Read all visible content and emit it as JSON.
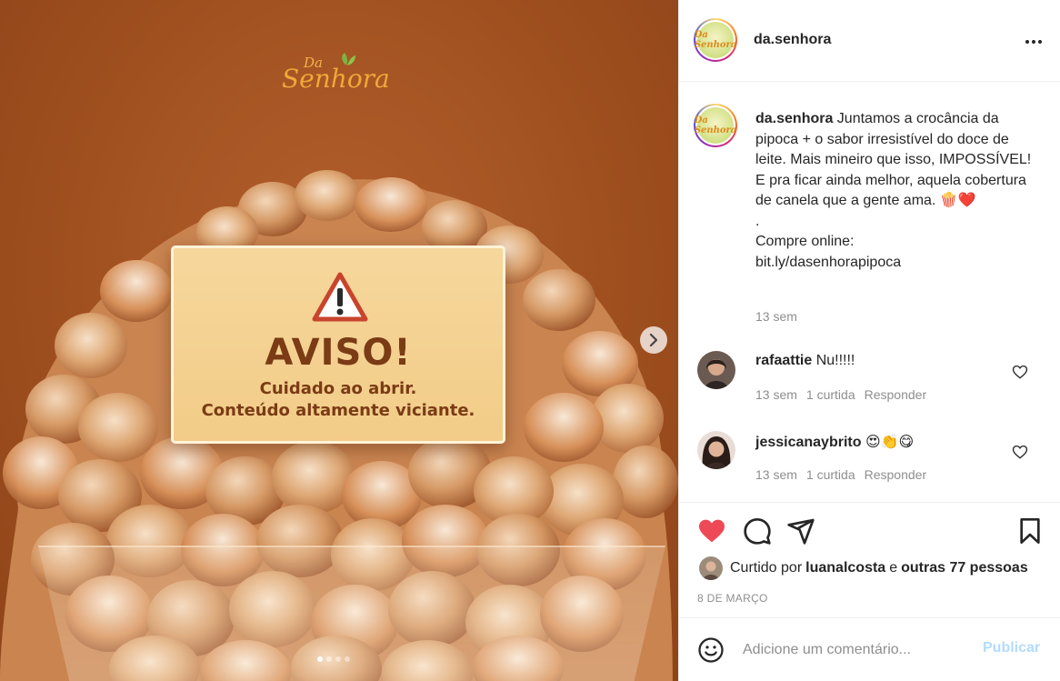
{
  "post_image": {
    "brand_logo": {
      "small": "Da",
      "large": "Senhora"
    },
    "warning": {
      "title": "AVISO!",
      "line1": "Cuidado ao abrir.",
      "line2": "Conteúdo altamente viciante."
    },
    "carousel": {
      "total_slides": 4,
      "active_slide": 1
    },
    "icons": {
      "next": "chevron-right-icon",
      "warning": "warning-triangle-icon"
    }
  },
  "header": {
    "username": "da.senhora",
    "avatar_text": "Da Senhora",
    "more_icon": "more-horizontal-icon"
  },
  "caption": {
    "username": "da.senhora",
    "text": " Juntamos a crocância da pipoca + o sabor irresistível do doce de leite. Mais mineiro que isso, IMPOSSÍVEL! E pra ficar ainda melhor, aquela cobertura de canela que a gente ama. 🍿❤️\n.\nCompre online:\nbit.ly/dasenhorapipoca",
    "time": "13 sem"
  },
  "comments": [
    {
      "username": "rafaattie",
      "text": " Nu!!!!!",
      "time": "13 sem",
      "likes": "1 curtida",
      "reply": "Responder"
    },
    {
      "username": "jessicanaybrito",
      "text": " 😍👏😋",
      "time": "13 sem",
      "likes": "1 curtida",
      "reply": "Responder"
    }
  ],
  "actions": {
    "icons": [
      "heart-filled-icon",
      "comment-icon",
      "share-icon",
      "bookmark-icon"
    ],
    "liked": true,
    "like_color": "#ed4956"
  },
  "likes": {
    "prefix": "Curtido por",
    "user": "luanalcosta",
    "joiner": "e",
    "others": "outras 77 pessoas"
  },
  "date": "8 DE MARÇO",
  "add_comment": {
    "placeholder": "Adicione um comentário...",
    "publish_label": "Publicar"
  },
  "colors": {
    "background_brown": "#a0501f",
    "warning_card": "#f6d79c",
    "warning_text": "#7a3b15",
    "meta_grey": "#8e8e8e",
    "publish_disabled": "#b3dbff"
  }
}
